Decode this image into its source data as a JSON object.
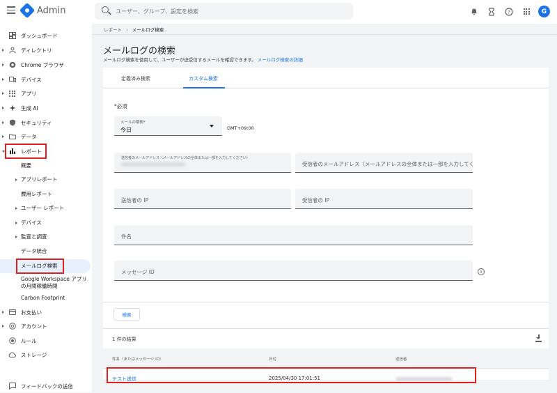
{
  "topbar": {
    "app_name": "Admin",
    "search_placeholder": "ユーザー、グループ、設定を検索",
    "avatar_letter": "G"
  },
  "sidebar": {
    "items": [
      {
        "label": "ダッシュボード",
        "icon": "dashboard-icon"
      },
      {
        "label": "ディレクトリ",
        "icon": "person-icon"
      },
      {
        "label": "Chrome ブラウザ",
        "icon": "chrome-icon"
      },
      {
        "label": "デバイス",
        "icon": "devices-icon"
      },
      {
        "label": "アプリ",
        "icon": "apps-grid-icon"
      },
      {
        "label": "生成 AI",
        "icon": "sparkle-icon"
      },
      {
        "label": "セキュリティ",
        "icon": "shield-icon"
      },
      {
        "label": "データ",
        "icon": "folder-icon"
      },
      {
        "label": "レポート",
        "icon": "bar-chart-icon"
      },
      {
        "label": "お支払い",
        "icon": "credit-card-icon"
      },
      {
        "label": "アカウント",
        "icon": "at-icon"
      },
      {
        "label": "ルール",
        "icon": "rules-icon"
      },
      {
        "label": "ストレージ",
        "icon": "cloud-icon"
      }
    ],
    "report_sub": [
      "概要",
      "アプリレポート",
      "費用レポート",
      "ユーザー レポート",
      "デバイス",
      "監査と調査",
      "データ統合",
      "メールログ検索",
      "Google Workspace アプリの月間稼働時間",
      "Carbon Footprint"
    ],
    "feedback": "フィードバックの送信"
  },
  "breadcrumb": {
    "parent": "レポート",
    "separator": "›",
    "current": "メールログ検索"
  },
  "page": {
    "title": "メールログの検索",
    "description": "メールログ検索を使用して、ユーザーが送受信するメールを確認できます。",
    "description_link": "メールログ検索の詳細"
  },
  "tabs": {
    "saved": "定義済み検索",
    "custom": "カスタム検索"
  },
  "form": {
    "required_note": "*必須",
    "period_label": "メールの期間*",
    "period_value": "今日",
    "timezone": "GMT+09:00",
    "sender_label": "送信者のメールアドレス（メールアドレスの全体または一部を入力してください）",
    "recipient_placeholder": "受信者のメールアドレス（メールアドレスの全体または一部を入力してください）",
    "sender_ip": "送信者の IP",
    "recipient_ip": "受信者の IP",
    "subject": "件名",
    "message_id": "メッセージ ID",
    "search_button": "検索"
  },
  "results": {
    "count_text": "1 件の結果",
    "columns": [
      "件名（またはメッセージ ID）",
      "日付",
      "送信者"
    ],
    "rows": [
      {
        "subject": "テスト送信",
        "date": "2025/04/30 17:01:51"
      }
    ]
  }
}
